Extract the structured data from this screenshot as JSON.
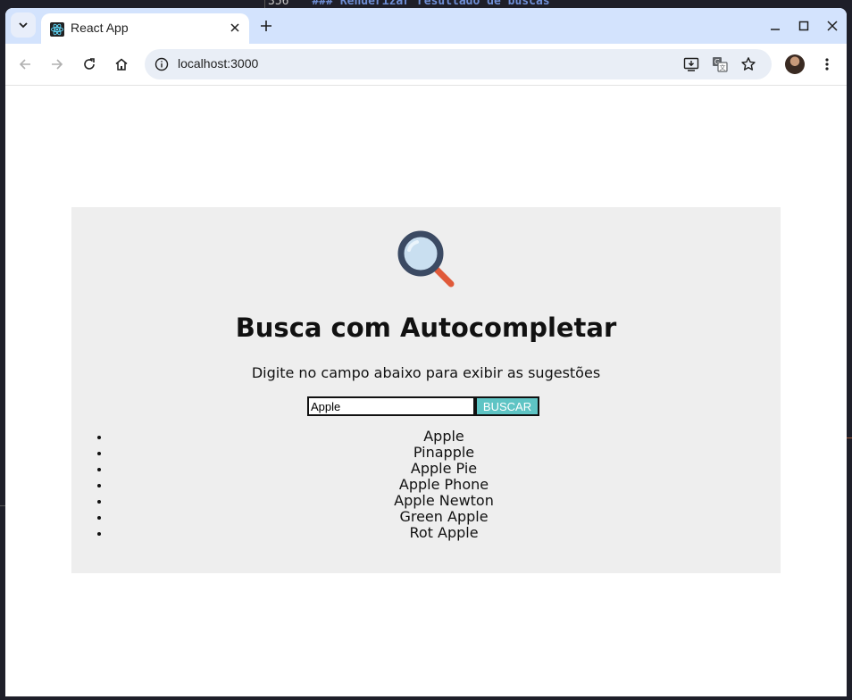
{
  "background": {
    "editor_line_number": "356",
    "editor_line_text": "### Renderizar resultado de buscas"
  },
  "browser": {
    "tab_title": "React App",
    "url": "localhost:3000",
    "colors": {
      "titlebar": "#d3e3fd",
      "omnibox": "#e9eef6"
    }
  },
  "page": {
    "heading": "Busca com Autocompletar",
    "subtitle": "Digite no campo abaixo para exibir as sugestões",
    "search": {
      "value": "Apple",
      "button_label": "BUSCAR"
    },
    "suggestions": [
      "Apple",
      "Pinapple",
      "Apple Pie",
      "Apple Phone",
      "Apple Newton",
      "Green Apple",
      "Rot Apple"
    ],
    "colors": {
      "card_background": "#eeeeee",
      "button_background": "#5ec4c4"
    }
  }
}
